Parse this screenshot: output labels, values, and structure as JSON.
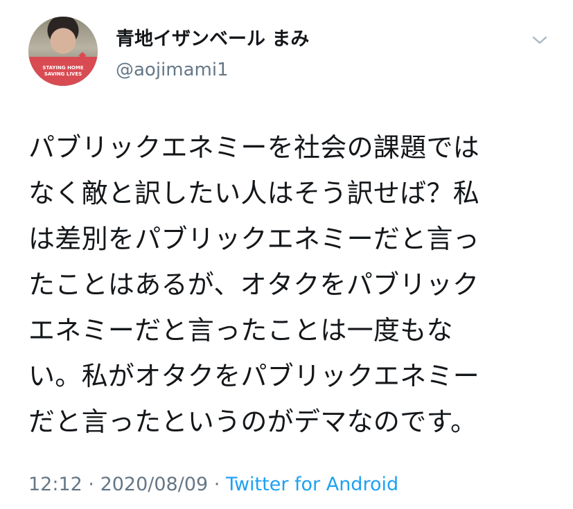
{
  "tweet": {
    "display_name": "青地イザンベール まみ",
    "handle": "@aojimami1",
    "avatar_badge": {
      "line1": "STAYING HOME",
      "line2": "SAVING LIVES"
    },
    "text_lines": [
      "パブリックエネミーを社会の課題では",
      "なく敵と訳したい人はそう訳せば？私",
      "は差別をパブリックエネミーだと言っ",
      "たことはあるが、オタクをパブリック",
      "エネミーだと言ったことは一度もな",
      "い。私がオタクをパブリックエネミー",
      "だと言ったというのがデマなのです。"
    ],
    "time": "12:12",
    "separator": " · ",
    "date": "2020/08/09",
    "separator2": " · ",
    "source": "Twitter for Android"
  },
  "icons": {
    "caret": "chevron-down-icon",
    "avatar_house": "house-icon"
  },
  "colors": {
    "text": "#14171a",
    "secondary": "#657786",
    "link": "#1da1f2",
    "avatar_band": "#d94b52"
  }
}
